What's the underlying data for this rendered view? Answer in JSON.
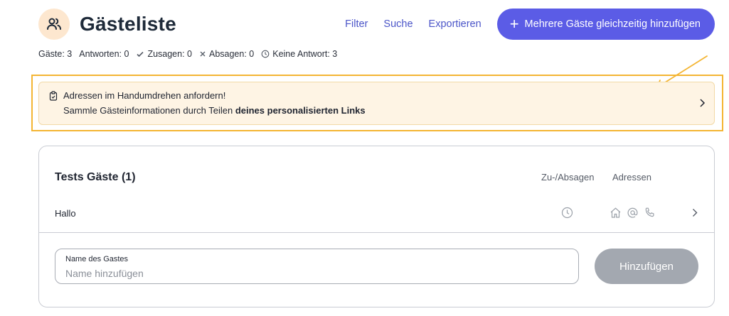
{
  "header": {
    "title": "Gästeliste",
    "nav": {
      "filter": "Filter",
      "search": "Suche",
      "export": "Exportieren"
    },
    "primary_button": "Mehrere Gäste gleichzeitig hinzufügen"
  },
  "stats": {
    "guests": "Gäste: 3",
    "responses": "Antworten: 0",
    "accepted": "Zusagen: 0",
    "declined": "Absagen: 0",
    "no_response": "Keine Antwort: 3"
  },
  "banner": {
    "title": "Adressen im Handumdrehen anfordern!",
    "text_prefix": "Sammle Gästeinformationen durch Teilen ",
    "text_bold": "deines personalisierten Links"
  },
  "group": {
    "title": "Tests Gäste (1)",
    "columns": {
      "rsvp": "Zu-/Absagen",
      "addresses": "Adressen"
    },
    "guests": [
      {
        "name": "Hallo"
      }
    ]
  },
  "add_guest": {
    "label": "Name des Gastes",
    "placeholder": "Name hinzufügen",
    "value": "",
    "button": "Hinzufügen"
  },
  "colors": {
    "accent": "#5b5ce6",
    "link": "#4b55c8",
    "highlight": "#f4b533",
    "banner_bg": "#fef4e4",
    "disabled_button": "#a3a8b0"
  }
}
